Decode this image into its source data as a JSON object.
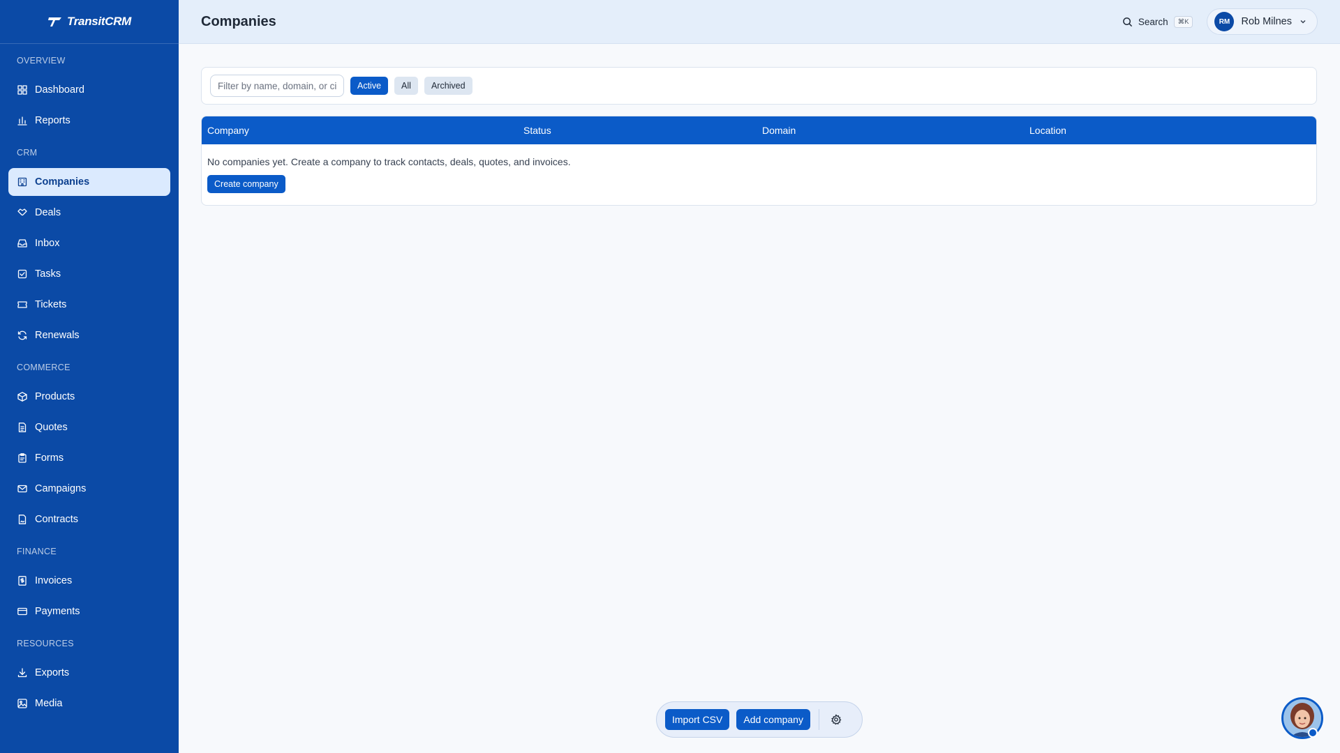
{
  "brand": {
    "name": "TransitCRM"
  },
  "sidebar": {
    "sections": [
      {
        "label": "OVERVIEW",
        "items": [
          {
            "label": "Dashboard",
            "icon": "dashboard-icon"
          },
          {
            "label": "Reports",
            "icon": "bar-chart-icon"
          }
        ]
      },
      {
        "label": "CRM",
        "items": [
          {
            "label": "Companies",
            "icon": "building-icon",
            "active": true
          },
          {
            "label": "Deals",
            "icon": "handshake-icon"
          },
          {
            "label": "Inbox",
            "icon": "inbox-icon"
          },
          {
            "label": "Tasks",
            "icon": "checkbox-icon"
          },
          {
            "label": "Tickets",
            "icon": "ticket-icon"
          },
          {
            "label": "Renewals",
            "icon": "refresh-icon"
          }
        ]
      },
      {
        "label": "COMMERCE",
        "items": [
          {
            "label": "Products",
            "icon": "package-icon"
          },
          {
            "label": "Quotes",
            "icon": "document-icon"
          },
          {
            "label": "Forms",
            "icon": "clipboard-icon"
          },
          {
            "label": "Campaigns",
            "icon": "mail-icon"
          },
          {
            "label": "Contracts",
            "icon": "contract-icon"
          }
        ]
      },
      {
        "label": "FINANCE",
        "items": [
          {
            "label": "Invoices",
            "icon": "invoice-icon"
          },
          {
            "label": "Payments",
            "icon": "credit-card-icon"
          }
        ]
      },
      {
        "label": "RESOURCES",
        "items": [
          {
            "label": "Exports",
            "icon": "download-icon"
          },
          {
            "label": "Media",
            "icon": "image-icon"
          }
        ]
      }
    ]
  },
  "header": {
    "title": "Companies",
    "search_label": "Search",
    "search_shortcut": "⌘K",
    "user": {
      "initials": "RM",
      "name": "Rob Milnes"
    }
  },
  "filters": {
    "placeholder": "Filter by name, domain, or city",
    "pills": [
      {
        "label": "Active",
        "active": true
      },
      {
        "label": "All",
        "active": false
      },
      {
        "label": "Archived",
        "active": false
      }
    ]
  },
  "table": {
    "columns": [
      "Company",
      "Status",
      "Domain",
      "Location"
    ],
    "empty_message": "No companies yet. Create a company to track contacts, deals, quotes, and invoices.",
    "create_label": "Create company"
  },
  "action_bar": {
    "import_label": "Import CSV",
    "add_label": "Add company"
  },
  "colors": {
    "sidebar": "#0b4aa6",
    "accent": "#0b5bc8",
    "active_bg": "#dbeafe",
    "topbar": "#e4eefa"
  }
}
